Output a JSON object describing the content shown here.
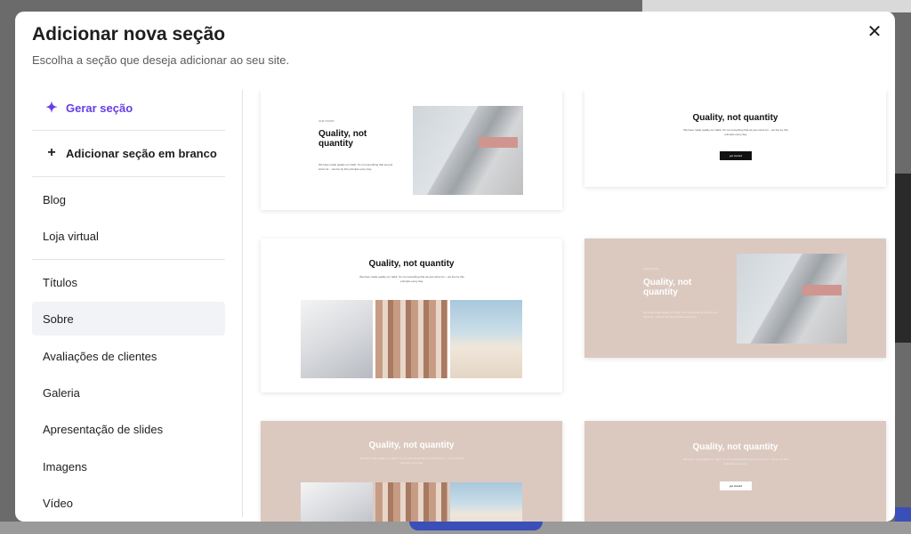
{
  "modal": {
    "title": "Adicionar nova seção",
    "subtitle": "Escolha a seção que deseja adicionar ao seu site."
  },
  "sidebar": {
    "generate": {
      "label": "Gerar seção",
      "icon": "sparkle-icon"
    },
    "blank": {
      "label": "Adicionar seção em branco",
      "icon": "plus-icon"
    },
    "items": [
      {
        "label": "Blog"
      },
      {
        "label": "Loja virtual"
      },
      {
        "label": "Títulos"
      },
      {
        "label": "Sobre",
        "active": true
      },
      {
        "label": "Avaliações de clientes"
      },
      {
        "label": "Galeria"
      },
      {
        "label": "Apresentação de slides"
      },
      {
        "label": "Imagens"
      },
      {
        "label": "Vídeo"
      }
    ]
  },
  "cards": {
    "c1": {
      "eyebrow": "OUR STORY",
      "title": "Quality, not quantity",
      "body": "We have made quality our habit. It's not something that we just strive for – we live by this principle every day."
    },
    "c2": {
      "title": "Quality, not quantity",
      "body": "We have made quality our habit. It's not something that we just strive for – we live by this principle every day.",
      "button": "get started"
    },
    "c3": {
      "title": "Quality, not quantity",
      "body": "We have made quality our habit. It's not something that we just strive for – we live by this principle every day."
    },
    "c4": {
      "eyebrow": "OUR STORY",
      "title": "Quality, not quantity",
      "body": "We have made quality our habit. It's not something that we just strive for – we live by this principle every day."
    },
    "c5": {
      "title": "Quality, not quantity",
      "body": "We have made quality our habit. It's not something that we just strive for – we live by this principle every day."
    },
    "c6": {
      "title": "Quality, not quantity",
      "body": "We have made quality our habit. It's not something that we just strive for – we live by this principle every day.",
      "button": "get started"
    }
  },
  "colors": {
    "accent": "#673de6",
    "beige": "#dbc9c0"
  }
}
